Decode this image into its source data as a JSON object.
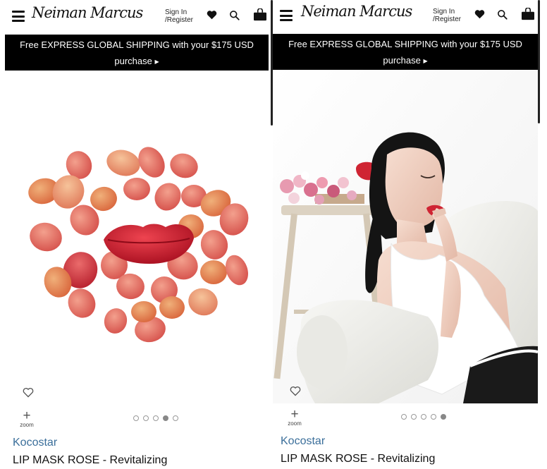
{
  "panels": [
    {
      "header": {
        "logo": "Neiman Marcus",
        "sign_in_line1": "Sign In",
        "sign_in_line2": "/Register"
      },
      "promo": {
        "text": "Free EXPRESS GLOBAL SHIPPING with your $175 USD",
        "link": "purchase"
      },
      "image": "rose-petals-lip-mask",
      "zoom_label": "zoom",
      "carousel": {
        "total": 5,
        "active": 4
      },
      "brand": "Kocostar",
      "product_name": "LIP MASK ROSE - Revitalizing"
    },
    {
      "header": {
        "logo": "Neiman Marcus",
        "sign_in_line1": "Sign In",
        "sign_in_line2": "/Register"
      },
      "promo": {
        "text": "Free EXPRESS GLOBAL SHIPPING with your $175 USD",
        "link": "purchase"
      },
      "image": "model-wearing-lip-mask",
      "zoom_label": "zoom",
      "carousel": {
        "total": 5,
        "active": 5
      },
      "brand": "Kocostar",
      "product_name": "LIP MASK ROSE - Revitalizing"
    }
  ],
  "colors": {
    "promo_bg": "#000000",
    "brand": "#3a6e9a",
    "accent": "#c8202c"
  },
  "icons": [
    "menu-icon",
    "heart-icon",
    "search-icon",
    "bag-icon",
    "zoom-icon"
  ]
}
